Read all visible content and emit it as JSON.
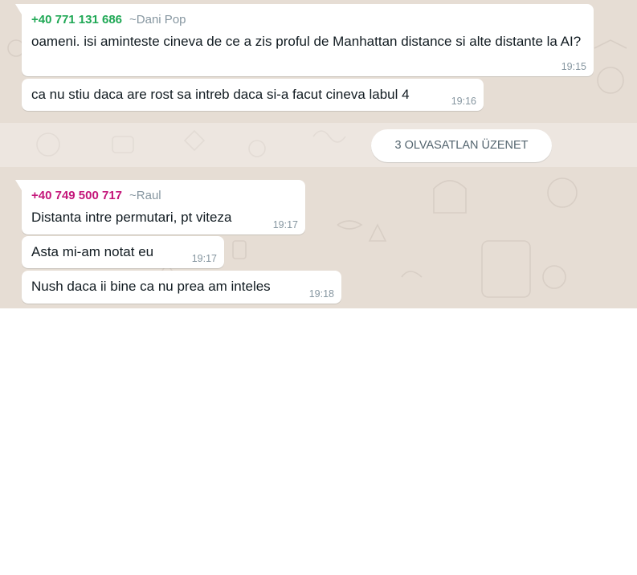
{
  "messages": [
    {
      "phone": "+40 771 131 686",
      "nick": "~Dani Pop",
      "phone_color": "#1fa855",
      "text": "oameni. isi aminteste cineva de ce a zis proful de Manhattan distance si alte distante la AI?",
      "time": "19:15"
    },
    {
      "text": "ca nu stiu daca are rost sa intreb daca si-a facut cineva labul 4",
      "time": "19:16"
    },
    {
      "phone": "+40 749 500 717",
      "nick": "~Raul",
      "phone_color": "#c4167a",
      "text": "Distanta intre permutari, pt viteza",
      "time": "19:17"
    },
    {
      "text": "Asta mi-am notat eu",
      "time": "19:17"
    },
    {
      "text": "Nush daca ii bine ca nu prea am inteles",
      "time": "19:18"
    }
  ],
  "unread_divider": {
    "label": "3 OLVASATLAN ÜZENET"
  }
}
